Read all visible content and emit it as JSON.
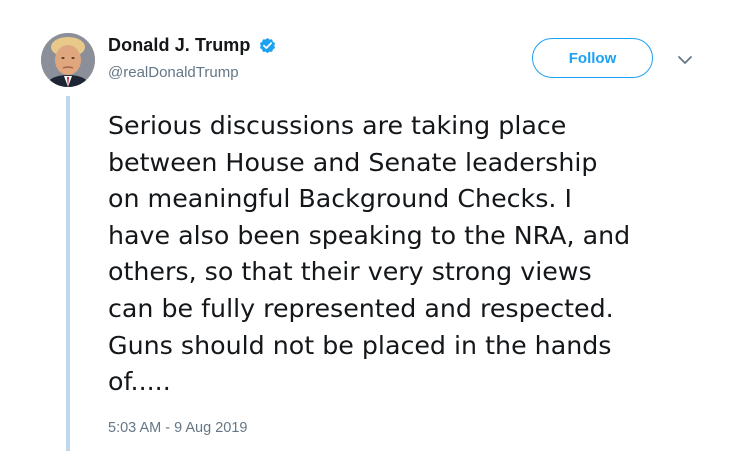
{
  "tweet": {
    "author": {
      "display_name": "Donald J. Trump",
      "handle": "@realDonaldTrump",
      "verified": true,
      "verified_icon": "verified-badge-icon"
    },
    "follow_label": "Follow",
    "caret_icon": "chevron-down-icon",
    "text": "Serious discussions are taking place\nbetween House and Senate leadership\non meaningful Background Checks. I\nhave also been speaking to the NRA, and\nothers, so that their very strong views\ncan be fully represented and respected.\nGuns should not be placed in the hands\nof.....",
    "timestamp": "5:03 AM - 9 Aug 2019"
  },
  "colors": {
    "accent": "#1da1f2",
    "text": "#14171a",
    "secondary_text": "#657786",
    "thread_line": "#bfd7ea"
  }
}
